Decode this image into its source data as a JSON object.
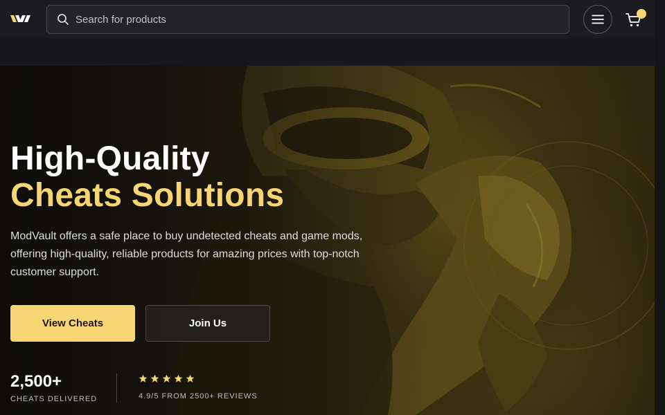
{
  "brand": {
    "logo_icon": "modvault-logo-icon"
  },
  "header": {
    "search": {
      "placeholder": "Search for products",
      "value": "",
      "icon": "search-icon"
    },
    "menu_icon": "hamburger-menu-icon",
    "cart_icon": "shopping-cart-icon"
  },
  "hero": {
    "title_line1": "High-Quality",
    "title_line2": "Cheats Solutions",
    "description": "ModVault offers a safe place to buy undetected cheats and game mods, offering high-quality, reliable products for amazing prices with top-notch customer support.",
    "primary_button": "View Cheats",
    "secondary_button": "Join Us",
    "stats": {
      "count": "2,500+",
      "count_label": "CHEATS DELIVERED",
      "star_count": 5,
      "rating_text": "4.9/5 FROM 2500+ REVIEWS"
    }
  },
  "colors": {
    "accent": "#f7d572",
    "background": "#151518",
    "header_bg": "#1c1c20"
  }
}
